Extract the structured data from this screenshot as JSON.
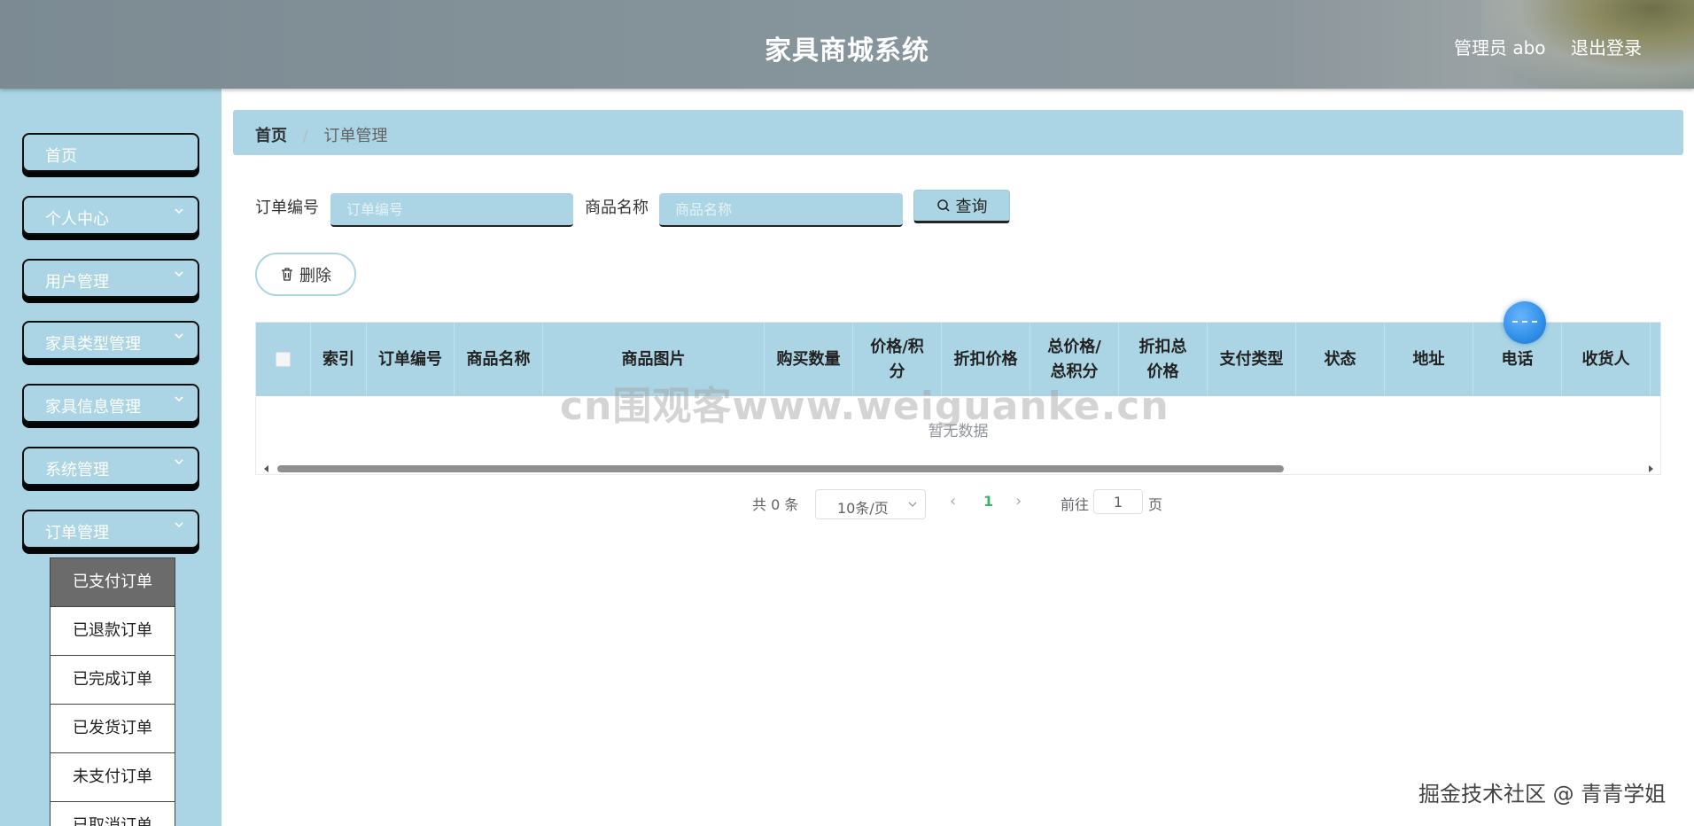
{
  "header": {
    "title": "家具商城系统",
    "user": "管理员 abo",
    "logout": "退出登录"
  },
  "sidebar": {
    "items": [
      {
        "label": "首页",
        "has_arrow": false
      },
      {
        "label": "个人中心",
        "has_arrow": true
      },
      {
        "label": "用户管理",
        "has_arrow": true
      },
      {
        "label": "家具类型管理",
        "has_arrow": true
      },
      {
        "label": "家具信息管理",
        "has_arrow": true
      },
      {
        "label": "系统管理",
        "has_arrow": true
      },
      {
        "label": "订单管理",
        "has_arrow": true
      }
    ],
    "submenu": [
      {
        "label": "已支付订单",
        "active": true
      },
      {
        "label": "已退款订单",
        "active": false
      },
      {
        "label": "已完成订单",
        "active": false
      },
      {
        "label": "已发货订单",
        "active": false
      },
      {
        "label": "未支付订单",
        "active": false
      },
      {
        "label": "已取消订单",
        "active": false
      }
    ]
  },
  "breadcrumb": {
    "home": "首页",
    "separator": "/",
    "current": "订单管理"
  },
  "search": {
    "order_no_label": "订单编号",
    "order_no_placeholder": "订单编号",
    "order_no_value": "",
    "product_name_label": "商品名称",
    "product_name_placeholder": "商品名称",
    "product_name_value": "",
    "query_button": "查询"
  },
  "actions": {
    "delete_button": "删除"
  },
  "table": {
    "columns": [
      {
        "label": ""
      },
      {
        "label": "索引"
      },
      {
        "label": "订单编号"
      },
      {
        "label": "商品名称"
      },
      {
        "label": "商品图片"
      },
      {
        "label": "购买数量"
      },
      {
        "label": "价格/积分"
      },
      {
        "label": "折扣价格"
      },
      {
        "label": "总价格/总积分"
      },
      {
        "label": "折扣总价格"
      },
      {
        "label": "支付类型"
      },
      {
        "label": "状态"
      },
      {
        "label": "地址"
      },
      {
        "label": "电话"
      },
      {
        "label": "收货人"
      }
    ],
    "rows": [],
    "empty_text": "暂无数据"
  },
  "pagination": {
    "total_text": "共 0 条",
    "page_size": "10条/页",
    "current_page": "1",
    "goto_label": "前往",
    "goto_value": "1",
    "page_suffix": "页"
  },
  "watermarks": {
    "center": "cn围观客www.weiguanke.cn",
    "corner": "掘金技术社区 @ 青青学姐"
  },
  "colors": {
    "accent": "#abd5e4",
    "header": "#87959c",
    "active_submenu": "#6b6b6b",
    "page_active": "#3cb371"
  }
}
